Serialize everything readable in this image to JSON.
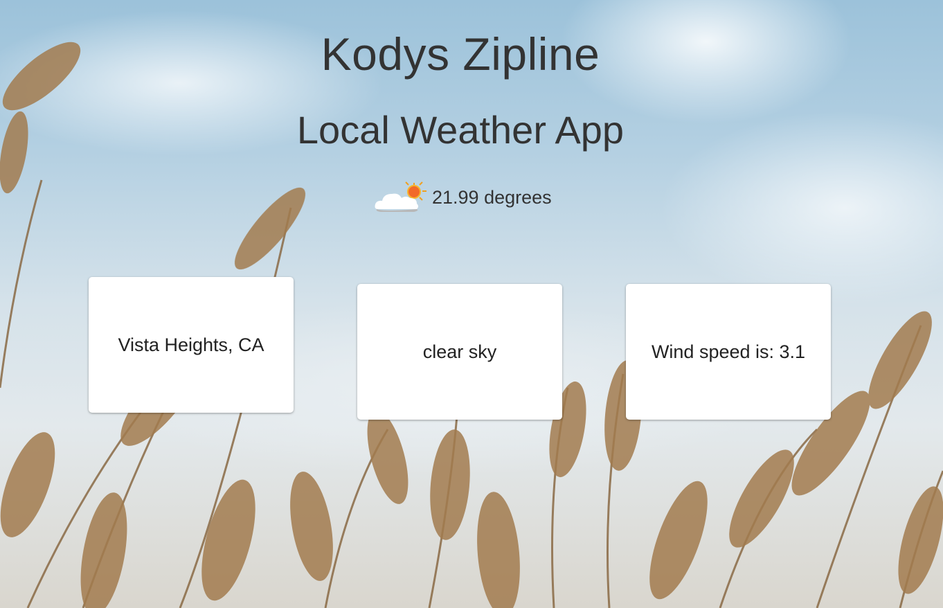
{
  "header": {
    "title": "Kodys Zipline",
    "subtitle": "Local Weather App"
  },
  "weather": {
    "icon": "partly-cloudy-icon",
    "temperature_text": "21.99 degrees"
  },
  "cards": {
    "location": "Vista Heights, CA",
    "description": "clear sky",
    "wind": "Wind speed is: 3.1"
  },
  "colors": {
    "text": "#333333",
    "card_background": "#ffffff",
    "sky": "#9cc2da",
    "grass": "#a07a4c"
  }
}
